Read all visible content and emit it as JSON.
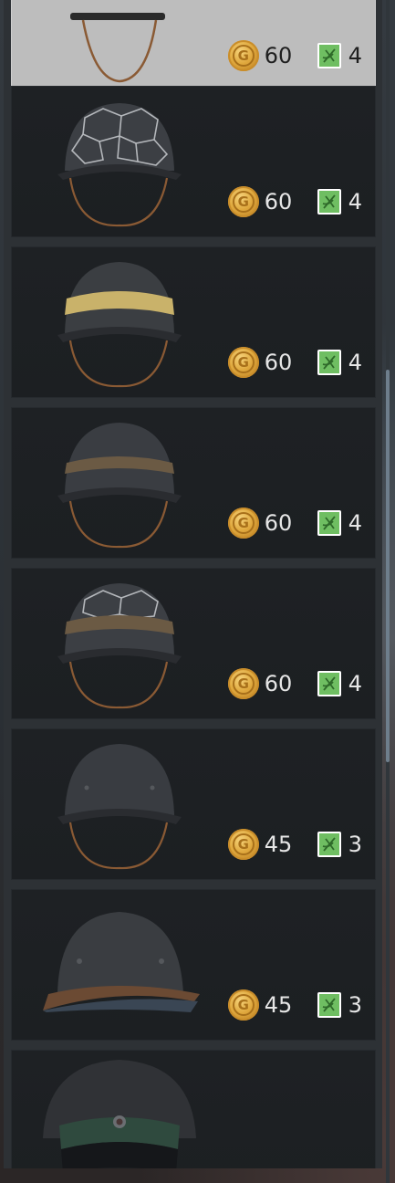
{
  "currency": {
    "coin_letter": "G"
  },
  "items": [
    {
      "helmet": "chin-strap-only",
      "gold": "60",
      "orders": "4",
      "selected": true
    },
    {
      "helmet": "netted-helmet",
      "gold": "60",
      "orders": "4",
      "selected": false
    },
    {
      "helmet": "yellow-band-helmet",
      "gold": "60",
      "orders": "4",
      "selected": false
    },
    {
      "helmet": "leather-band-helmet",
      "gold": "60",
      "orders": "4",
      "selected": false
    },
    {
      "helmet": "netted-band-helmet",
      "gold": "60",
      "orders": "4",
      "selected": false
    },
    {
      "helmet": "plain-helmet",
      "gold": "45",
      "orders": "3",
      "selected": false
    },
    {
      "helmet": "flared-helmet",
      "gold": "45",
      "orders": "3",
      "selected": false
    },
    {
      "helmet": "peaked-cap",
      "gold": "",
      "orders": "",
      "selected": false
    }
  ],
  "colors": {
    "gold_coin": "#e0a93e",
    "orders_green": "#6fbe62",
    "selected_bg": "#bdbdbd",
    "card_bg": "#1e2124"
  }
}
